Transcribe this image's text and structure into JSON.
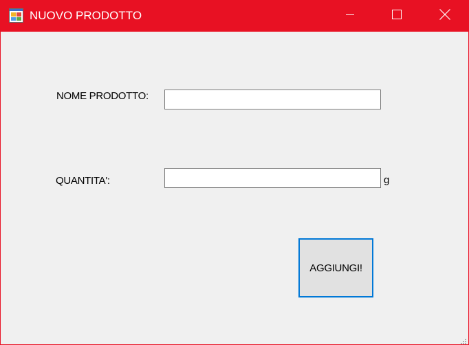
{
  "window": {
    "title": "NUOVO PRODOTTO",
    "icons": {
      "app": "app-form-icon",
      "minimize": "minimize-icon",
      "maximize": "maximize-icon",
      "close": "close-icon",
      "grip": "resize-grip-icon"
    },
    "colors": {
      "titlebar": "#e81123",
      "background": "#f0f0f0",
      "focus_border": "#0078d7"
    }
  },
  "form": {
    "product_name_label": "NOME PRODOTTO:",
    "product_name_value": "",
    "quantity_label": "QUANTITA':",
    "quantity_value": "",
    "quantity_unit": "g",
    "add_button_label": "AGGIUNGI!"
  }
}
